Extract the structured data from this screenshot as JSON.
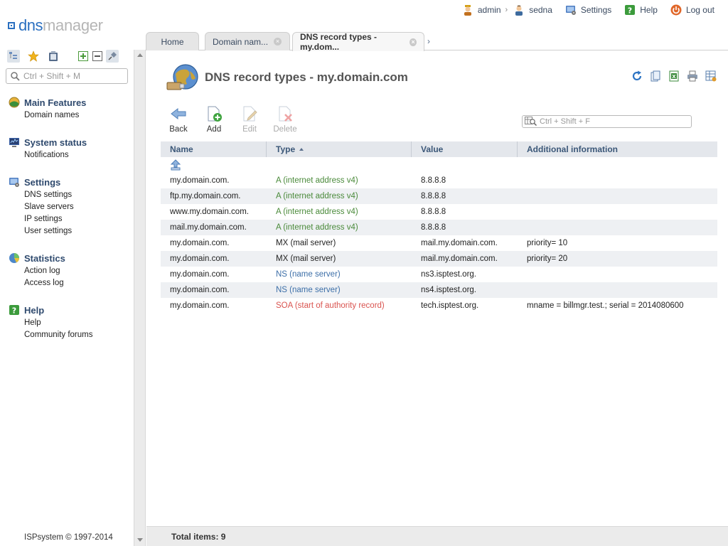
{
  "logo": {
    "dns": "dns",
    "manager": "manager"
  },
  "topbar": {
    "user": "admin",
    "separator": "›",
    "account": "sedna",
    "settings": "Settings",
    "help": "Help",
    "logout": "Log out"
  },
  "sidebar": {
    "search_placeholder": "Ctrl + Shift + M",
    "groups": [
      {
        "title": "Main Features",
        "items": [
          "Domain names"
        ]
      },
      {
        "title": "System status",
        "items": [
          "Notifications"
        ]
      },
      {
        "title": "Settings",
        "items": [
          "DNS settings",
          "Slave servers",
          "IP settings",
          "User settings"
        ]
      },
      {
        "title": "Statistics",
        "items": [
          "Action log",
          "Access log"
        ]
      },
      {
        "title": "Help",
        "items": [
          "Help",
          "Community forums"
        ]
      }
    ],
    "copyright": "ISPsystem © 1997-2014"
  },
  "tabs": [
    {
      "label": "Home"
    },
    {
      "label": "Domain nam..."
    },
    {
      "label": "DNS record types - my.dom..."
    }
  ],
  "page": {
    "title": "DNS record types - my.domain.com",
    "actions": {
      "back": "Back",
      "add": "Add",
      "edit": "Edit",
      "delete": "Delete"
    },
    "table_search_placeholder": "Ctrl + Shift + F",
    "total": "Total items: 9"
  },
  "colors": {
    "type_a": "#4a8a3a",
    "type_mx": "#222222",
    "type_ns": "#3d6fa8",
    "type_soa": "#d9534f"
  },
  "table": {
    "columns": [
      "Name",
      "Type",
      "Value",
      "Additional information"
    ],
    "rows": [
      {
        "name": "my.domain.com.",
        "type": "A (internet address v4)",
        "type_color": "#4a8a3a",
        "value": "8.8.8.8",
        "info": ""
      },
      {
        "name": "ftp.my.domain.com.",
        "type": "A (internet address v4)",
        "type_color": "#4a8a3a",
        "value": "8.8.8.8",
        "info": ""
      },
      {
        "name": "www.my.domain.com.",
        "type": "A (internet address v4)",
        "type_color": "#4a8a3a",
        "value": "8.8.8.8",
        "info": ""
      },
      {
        "name": "mail.my.domain.com.",
        "type": "A (internet address v4)",
        "type_color": "#4a8a3a",
        "value": "8.8.8.8",
        "info": ""
      },
      {
        "name": "my.domain.com.",
        "type": "MX (mail server)",
        "type_color": "#222222",
        "value": "mail.my.domain.com.",
        "info": "priority= 10"
      },
      {
        "name": "my.domain.com.",
        "type": "MX (mail server)",
        "type_color": "#222222",
        "value": "mail.my.domain.com.",
        "info": "priority= 20"
      },
      {
        "name": "my.domain.com.",
        "type": "NS (name server)",
        "type_color": "#3d6fa8",
        "value": "ns3.isptest.org.",
        "info": ""
      },
      {
        "name": "my.domain.com.",
        "type": "NS (name server)",
        "type_color": "#3d6fa8",
        "value": "ns4.isptest.org.",
        "info": ""
      },
      {
        "name": "my.domain.com.",
        "type": "SOA (start of authority record)",
        "type_color": "#d9534f",
        "value": "tech.isptest.org.",
        "info": "mname = billmgr.test.; serial = 2014080600"
      }
    ]
  }
}
